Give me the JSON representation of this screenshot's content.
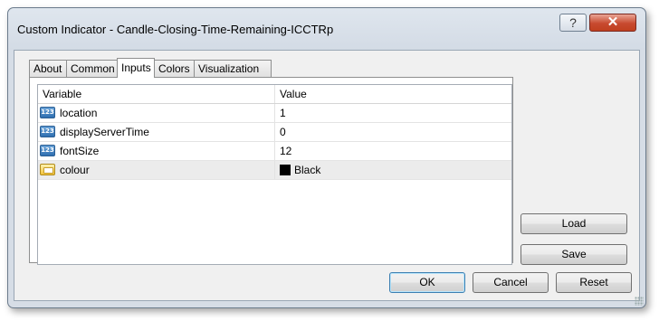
{
  "window": {
    "title": "Custom Indicator - Candle-Closing-Time-Remaining-ICCTRp",
    "help_label": "?",
    "close_label": "✕"
  },
  "tabs": [
    {
      "label": "About"
    },
    {
      "label": "Common"
    },
    {
      "label": "Inputs",
      "active": true
    },
    {
      "label": "Colors"
    },
    {
      "label": "Visualization"
    }
  ],
  "grid": {
    "headers": {
      "variable": "Variable",
      "value": "Value"
    },
    "rows": [
      {
        "type_icon": "integer-type-icon",
        "icon_text": "123",
        "variable": "location",
        "value": "1"
      },
      {
        "type_icon": "integer-type-icon",
        "icon_text": "123",
        "variable": "displayServerTime",
        "value": "0"
      },
      {
        "type_icon": "integer-type-icon",
        "icon_text": "123",
        "variable": "fontSize",
        "value": "12"
      },
      {
        "type_icon": "color-type-icon",
        "variable": "colour",
        "value": "Black",
        "swatch_color": "#000000"
      }
    ]
  },
  "side_buttons": {
    "load": "Load",
    "save": "Save"
  },
  "footer_buttons": {
    "ok": "OK",
    "cancel": "Cancel",
    "reset": "Reset"
  }
}
